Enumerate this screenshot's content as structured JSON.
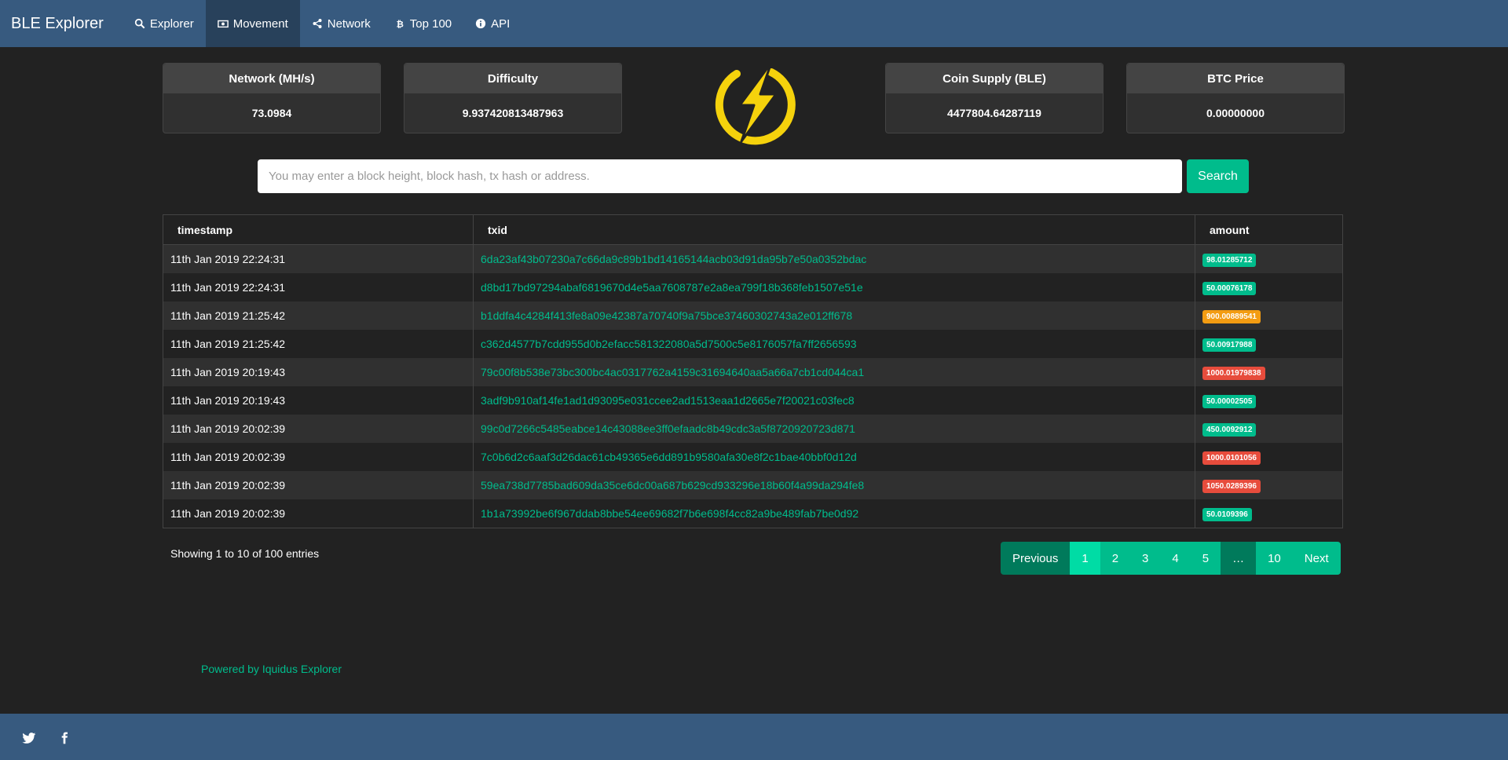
{
  "nav": {
    "brand": "BLE Explorer",
    "items": [
      {
        "label": "Explorer",
        "icon": "search-icon"
      },
      {
        "label": "Movement",
        "icon": "money-icon",
        "active": true
      },
      {
        "label": "Network",
        "icon": "share-icon"
      },
      {
        "label": "Top 100",
        "icon": "bitcoin-icon"
      },
      {
        "label": "API",
        "icon": "info-icon"
      }
    ]
  },
  "stats": {
    "network": {
      "label": "Network (MH/s)",
      "value": "73.0984"
    },
    "difficulty": {
      "label": "Difficulty",
      "value": "9.937420813487963"
    },
    "supply": {
      "label": "Coin Supply (BLE)",
      "value": "4477804.64287119"
    },
    "price": {
      "label": "BTC Price",
      "value": "0.00000000"
    }
  },
  "logo": {
    "icon": "lightning-bolt-icon",
    "color": "#f5d20c"
  },
  "search": {
    "placeholder": "You may enter a block height, block hash, tx hash or address.",
    "button": "Search"
  },
  "table": {
    "headers": {
      "timestamp": "timestamp",
      "txid": "txid",
      "amount": "amount"
    },
    "rows": [
      {
        "timestamp": "11th Jan 2019 22:24:31",
        "txid": "6da23af43b07230a7c66da9c89b1bd14165144acb03d91da95b7e50a0352bdac",
        "amount": "98.01285712",
        "color": "#00bc8c"
      },
      {
        "timestamp": "11th Jan 2019 22:24:31",
        "txid": "d8bd17bd97294abaf6819670d4e5aa7608787e2a8ea799f18b368feb1507e51e",
        "amount": "50.00076178",
        "color": "#00bc8c"
      },
      {
        "timestamp": "11th Jan 2019 21:25:42",
        "txid": "b1ddfa4c4284f413fe8a09e42387a70740f9a75bce37460302743a2e012ff678",
        "amount": "900.00889541",
        "color": "#f39c12"
      },
      {
        "timestamp": "11th Jan 2019 21:25:42",
        "txid": "c362d4577b7cdd955d0b2efacc581322080a5d7500c5e8176057fa7ff2656593",
        "amount": "50.00917988",
        "color": "#00bc8c"
      },
      {
        "timestamp": "11th Jan 2019 20:19:43",
        "txid": "79c00f8b538e73bc300bc4ac0317762a4159c31694640aa5a66a7cb1cd044ca1",
        "amount": "1000.01979838",
        "color": "#e74c3c"
      },
      {
        "timestamp": "11th Jan 2019 20:19:43",
        "txid": "3adf9b910af14fe1ad1d93095e031ccee2ad1513eaa1d2665e7f20021c03fec8",
        "amount": "50.00002505",
        "color": "#00bc8c"
      },
      {
        "timestamp": "11th Jan 2019 20:02:39",
        "txid": "99c0d7266c5485eabce14c43088ee3ff0efaadc8b49cdc3a5f8720920723d871",
        "amount": "450.0092912",
        "color": "#00bc8c"
      },
      {
        "timestamp": "11th Jan 2019 20:02:39",
        "txid": "7c0b6d2c6aaf3d26dac61cb49365e6dd891b9580afa30e8f2c1bae40bbf0d12d",
        "amount": "1000.0101056",
        "color": "#e74c3c"
      },
      {
        "timestamp": "11th Jan 2019 20:02:39",
        "txid": "59ea738d7785bad609da35ce6dc00a687b629cd933296e18b60f4a99da294fe8",
        "amount": "1050.0289396",
        "color": "#e74c3c"
      },
      {
        "timestamp": "11th Jan 2019 20:02:39",
        "txid": "1b1a73992be6f967ddab8bbe54ee69682f7b6e698f4cc82a9be489fab7be0d92",
        "amount": "50.0109396",
        "color": "#00bc8c"
      }
    ]
  },
  "info": {
    "showing": "Showing 1 to 10 of 100 entries"
  },
  "pagination": {
    "previous": "Previous",
    "pages": [
      "1",
      "2",
      "3",
      "4",
      "5"
    ],
    "ellipsis": "…",
    "last_page": "10",
    "next": "Next",
    "current": "1"
  },
  "footer": {
    "powered": "Powered by Iquidus Explorer",
    "social": [
      "twitter-icon",
      "facebook-icon"
    ]
  }
}
